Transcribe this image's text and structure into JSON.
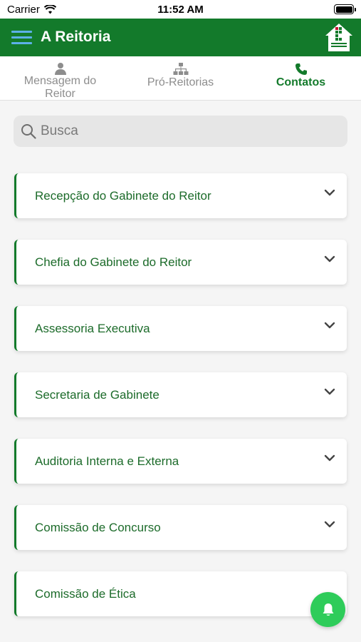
{
  "status_bar": {
    "carrier": "Carrier",
    "time": "11:52 AM"
  },
  "header": {
    "title": "A Reitoria",
    "menu_icon": "hamburger-menu-icon",
    "logo": "instituto-federal-logo"
  },
  "tabs": [
    {
      "label": "Mensagem do Reitor",
      "icon": "person-icon",
      "active": false
    },
    {
      "label": "Pró-Reitorias",
      "icon": "org-chart-icon",
      "active": false
    },
    {
      "label": "Contatos",
      "icon": "phone-icon",
      "active": true
    }
  ],
  "search": {
    "placeholder": "Busca",
    "value": ""
  },
  "contacts": [
    {
      "label": "Recepção do Gabinete do Reitor"
    },
    {
      "label": "Chefia do Gabinete do Reitor"
    },
    {
      "label": "Assessoria Executiva"
    },
    {
      "label": "Secretaria de Gabinete"
    },
    {
      "label": "Auditoria Interna e Externa"
    },
    {
      "label": "Comissão de Concurso"
    },
    {
      "label": "Comissão de Ética"
    }
  ],
  "fab": {
    "icon": "bell-icon"
  },
  "colors": {
    "primary": "#137a2b",
    "accent": "#2ecc5a",
    "menu": "#5db0e8"
  }
}
